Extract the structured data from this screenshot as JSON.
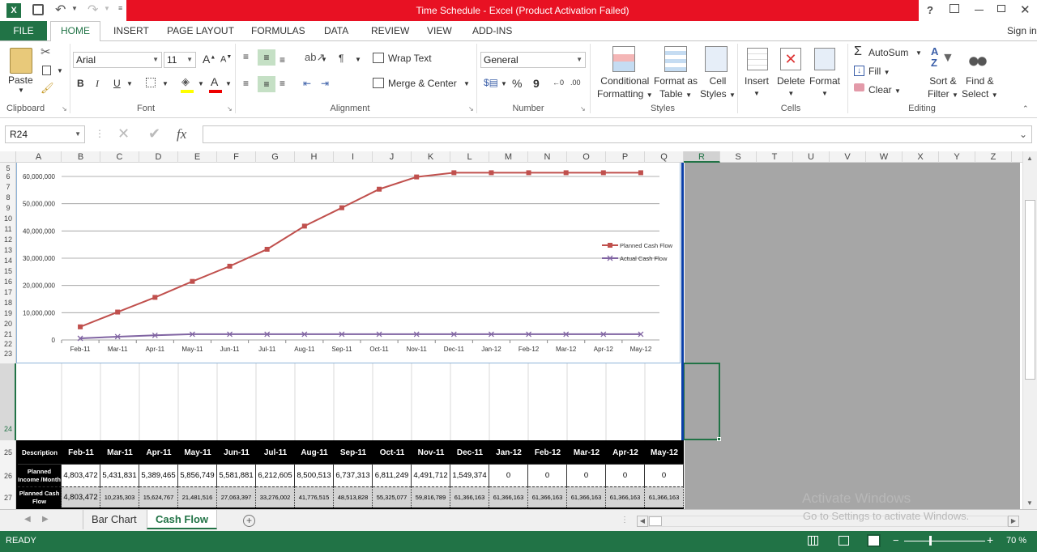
{
  "window": {
    "title": "Time Schedule -  Excel (Product Activation Failed)",
    "help": "?"
  },
  "tabs": {
    "file": "FILE",
    "home": "HOME",
    "items": [
      "INSERT",
      "PAGE LAYOUT",
      "FORMULAS",
      "DATA",
      "REVIEW",
      "VIEW",
      "ADD-INS"
    ],
    "signin": "Sign in"
  },
  "ribbon": {
    "clipboard": {
      "paste": "Paste",
      "label": "Clipboard"
    },
    "font": {
      "name": "Arial",
      "size": "11",
      "bold": "B",
      "italic": "I",
      "underline": "U",
      "label": "Font"
    },
    "alignment": {
      "wrap": "Wrap Text",
      "merge": "Merge & Center",
      "label": "Alignment"
    },
    "number": {
      "format": "General",
      "percent": "%",
      "comma": "9",
      "label": "Number"
    },
    "styles": {
      "conditional": [
        "Conditional",
        "Formatting"
      ],
      "formatTable": [
        "Format as",
        "Table"
      ],
      "cellStyles": [
        "Cell",
        "Styles"
      ],
      "label": "Styles"
    },
    "cells": {
      "insert": "Insert",
      "delete": "Delete",
      "format": "Format",
      "label": "Cells"
    },
    "editing": {
      "autosum": "AutoSum",
      "fill": "Fill",
      "clear": "Clear",
      "sort": [
        "Sort &",
        "Filter"
      ],
      "find": [
        "Find &",
        "Select"
      ],
      "label": "Editing"
    }
  },
  "formulaBar": {
    "nameBox": "R24",
    "fx": "fx",
    "value": ""
  },
  "columns": [
    "A",
    "B",
    "C",
    "D",
    "E",
    "F",
    "G",
    "H",
    "I",
    "J",
    "K",
    "L",
    "M",
    "N",
    "O",
    "P",
    "Q",
    "R",
    "S",
    "T",
    "U",
    "V",
    "W",
    "X",
    "Y",
    "Z"
  ],
  "rows": [
    "5",
    "6",
    "7",
    "8",
    "9",
    "10",
    "11",
    "12",
    "13",
    "14",
    "15",
    "16",
    "17",
    "18",
    "19",
    "20",
    "21",
    "22",
    "23",
    "24",
    "25",
    "26",
    "27"
  ],
  "chart_data": {
    "type": "line",
    "categories": [
      "Feb-11",
      "Mar-11",
      "Apr-11",
      "May-11",
      "Jun-11",
      "Jul-11",
      "Aug-11",
      "Sep-11",
      "Oct-11",
      "Nov-11",
      "Dec-11",
      "Jan-12",
      "Feb-12",
      "Mar-12",
      "Apr-12",
      "May-12"
    ],
    "series": [
      {
        "name": "Planned Cash Flow",
        "color": "#c0504d",
        "marker": "square",
        "values": [
          4803472,
          10235303,
          15624767,
          21481516,
          27063397,
          33276002,
          41776515,
          48513828,
          55325077,
          59816789,
          61366163,
          61366163,
          61366163,
          61366163,
          61366163,
          61366163
        ]
      },
      {
        "name": "Actual  Cash Flow",
        "color": "#8064a2",
        "marker": "x",
        "values": [
          600000,
          1200000,
          1700000,
          2100000,
          2100000,
          2100000,
          2100000,
          2100000,
          2100000,
          2100000,
          2100000,
          2100000,
          2100000,
          2100000,
          2100000,
          2100000
        ]
      }
    ],
    "yticks": [
      "0",
      "10,000,000",
      "20,000,000",
      "30,000,000",
      "40,000,000",
      "50,000,000",
      "60,000,000"
    ],
    "ylim": [
      0,
      65000000
    ],
    "grid": true,
    "legend": "right"
  },
  "table": {
    "header": [
      "Description",
      "Feb-11",
      "Mar-11",
      "Apr-11",
      "May-11",
      "Jun-11",
      "Jul-11",
      "Aug-11",
      "Sep-11",
      "Oct-11",
      "Nov-11",
      "Dec-11",
      "Jan-12",
      "Feb-12",
      "Mar-12",
      "Apr-12",
      "May-12"
    ],
    "row1": [
      "Planned Income /Month",
      "4,803,472",
      "5,431,831",
      "5,389,465",
      "5,856,749",
      "5,581,881",
      "6,212,605",
      "8,500,513",
      "6,737,313",
      "6,811,249",
      "4,491,712",
      "1,549,374",
      "0",
      "0",
      "0",
      "0",
      "0"
    ],
    "row2": [
      "Planned Cash Flow",
      "4,803,472",
      "10,235,303",
      "15,624,767",
      "21,481,516",
      "27,063,397",
      "33,276,002",
      "41,776,515",
      "48,513,828",
      "55,325,077",
      "59,816,789",
      "61,366,163",
      "61,366,163",
      "61,366,163",
      "61,366,163",
      "61,366,163",
      "61,366,163"
    ]
  },
  "sheets": [
    "Bar Chart",
    "Cash Flow"
  ],
  "status": {
    "ready": "READY",
    "zoom": "70 %"
  },
  "watermark": {
    "line1": "Activate Windows",
    "line2": "Go to Settings to activate Windows."
  }
}
